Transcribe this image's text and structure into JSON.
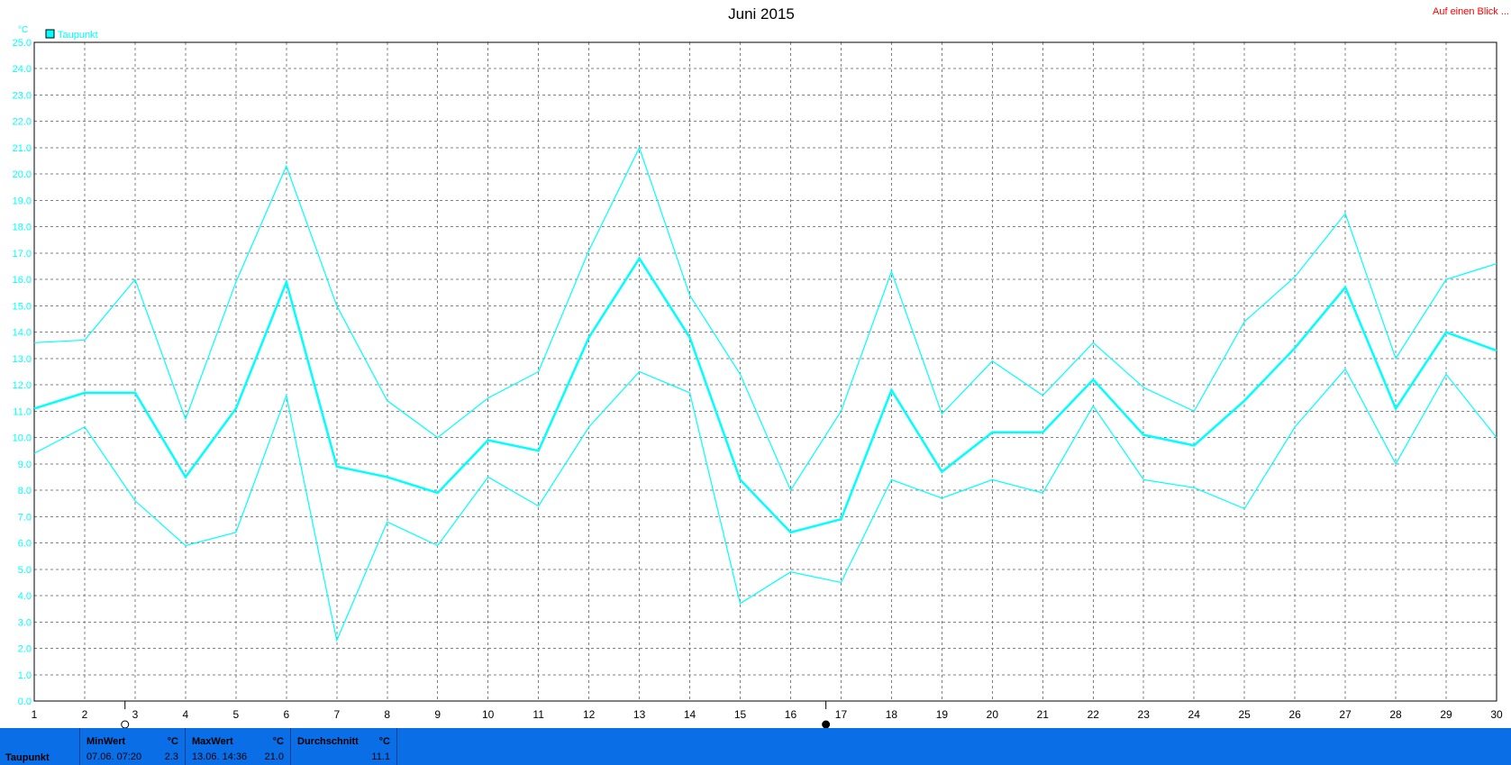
{
  "chart_data": {
    "type": "line",
    "title": "Juni 2015",
    "corner_label": "Auf einen Blick ...",
    "yunit": "°C",
    "legend": [
      {
        "name": "Taupunkt",
        "color": "#00ffff"
      }
    ],
    "legend_placement": "top-left",
    "grid": true,
    "x": [
      1,
      2,
      3,
      4,
      5,
      6,
      7,
      8,
      9,
      10,
      11,
      12,
      13,
      14,
      15,
      16,
      17,
      18,
      19,
      20,
      21,
      22,
      23,
      24,
      25,
      26,
      27,
      28,
      29,
      30
    ],
    "xlim": [
      1,
      30
    ],
    "ylim": [
      0,
      25
    ],
    "ytick_step": 1,
    "series": [
      {
        "role": "max",
        "values": [
          13.6,
          13.7,
          16.0,
          10.7,
          15.9,
          20.3,
          15.0,
          11.4,
          10.0,
          11.5,
          12.5,
          17.1,
          21.0,
          15.4,
          12.4,
          8.0,
          11.0,
          16.3,
          10.9,
          12.9,
          11.6,
          13.6,
          11.9,
          11.0,
          14.4,
          16.1,
          18.5,
          13.0,
          16.0,
          16.6
        ]
      },
      {
        "role": "avg",
        "values": [
          11.1,
          11.7,
          11.7,
          8.5,
          11.1,
          15.9,
          8.9,
          8.5,
          7.9,
          9.9,
          9.5,
          13.8,
          16.8,
          13.8,
          8.4,
          6.4,
          6.9,
          11.8,
          8.7,
          10.2,
          10.2,
          12.2,
          10.1,
          9.7,
          11.4,
          13.4,
          15.7,
          11.1,
          14.0,
          13.3
        ]
      },
      {
        "role": "min",
        "values": [
          9.4,
          10.4,
          7.6,
          5.9,
          6.4,
          11.6,
          2.3,
          6.8,
          5.9,
          8.5,
          7.4,
          10.4,
          12.5,
          11.7,
          3.7,
          4.9,
          4.5,
          8.4,
          7.7,
          8.4,
          7.9,
          11.2,
          8.4,
          8.1,
          7.3,
          10.4,
          12.6,
          9.0,
          12.4,
          10.0
        ]
      }
    ],
    "moon_markers": [
      {
        "x": 2.8,
        "phase": "full-moon"
      },
      {
        "x": 16.7,
        "phase": "new-moon"
      }
    ]
  },
  "footer": {
    "row_label": "Taupunkt",
    "min": {
      "header": "MinWert",
      "unit": "°C",
      "when": "07.06.  07:20",
      "value": "2.3"
    },
    "max": {
      "header": "MaxWert",
      "unit": "°C",
      "when": "13.06.  14:36",
      "value": "21.0"
    },
    "avg": {
      "header": "Durchschnitt",
      "unit": "°C",
      "value": "11.1"
    }
  },
  "colors": {
    "series": "#00ffff",
    "grid": "#808080",
    "corner_label": "#ff0000",
    "footer_bg": "#0a6ee6"
  }
}
